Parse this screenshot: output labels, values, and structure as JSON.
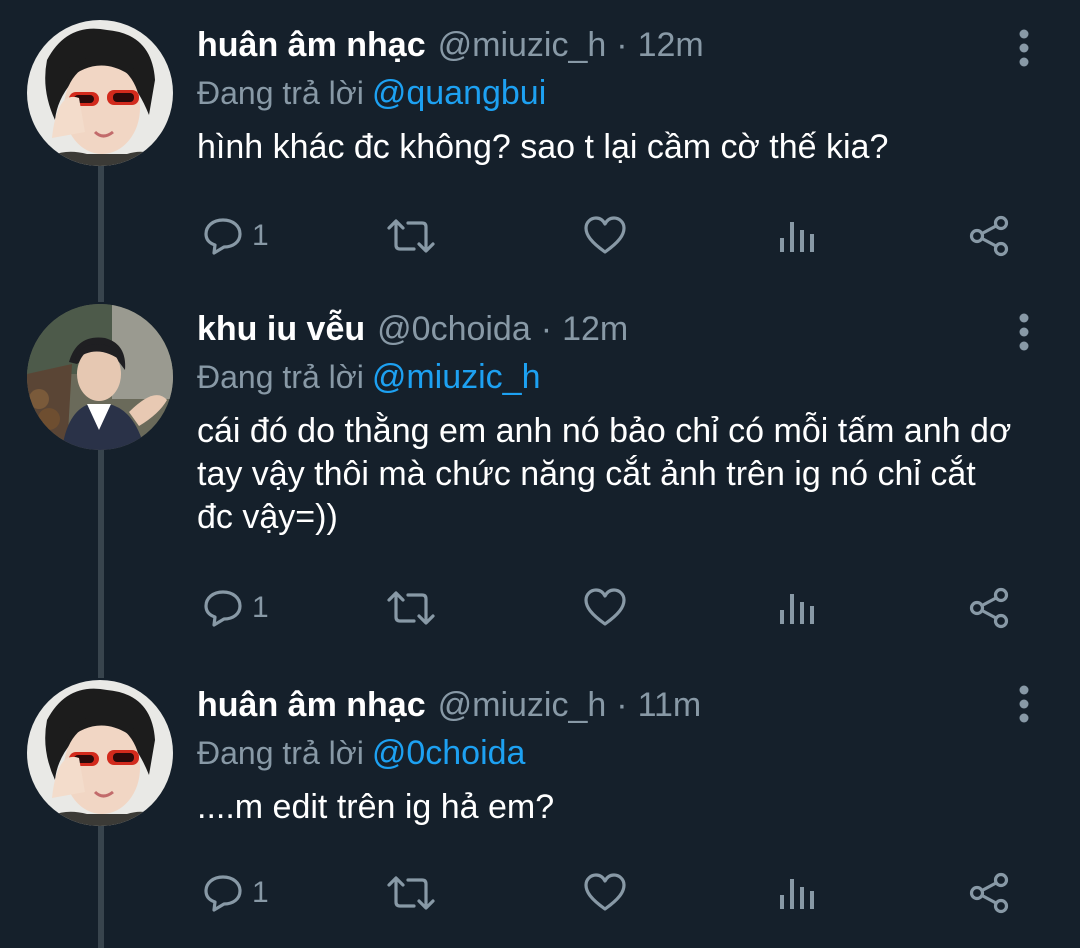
{
  "colors": {
    "background": "#15202b",
    "name": "#ffffff",
    "secondary": "#8899a6",
    "mention": "#1da1f2",
    "thread_line": "#38444d"
  },
  "tweets": [
    {
      "name": "huân âm nhạc",
      "handle": "@miuzic_h",
      "separator": "·",
      "time": "12m",
      "reply_prefix": "Đang trả lời",
      "reply_to": "@quangbui",
      "text": "hình khác đc không? sao t lại cầm cờ thế kia?",
      "reply_count": "1",
      "avatar": "avatar-red-glasses"
    },
    {
      "name": "khu iu vễu",
      "handle": "@0choida",
      "separator": "·",
      "time": "12m",
      "reply_prefix": "Đang trả lời",
      "reply_to": "@miuzic_h",
      "text": "cái đó do thằng em anh nó bảo chỉ có mỗi tấm anh dơ tay vậy thôi mà chức năng cắt ảnh trên ig nó chỉ cắt đc vậy=))",
      "reply_count": "1",
      "avatar": "avatar-outdoor-photo"
    },
    {
      "name": "huân âm nhạc",
      "handle": "@miuzic_h",
      "separator": "·",
      "time": "11m",
      "reply_prefix": "Đang trả lời",
      "reply_to": "@0choida",
      "text": "....m edit trên ig hả em?",
      "reply_count": "1",
      "avatar": "avatar-red-glasses"
    }
  ]
}
